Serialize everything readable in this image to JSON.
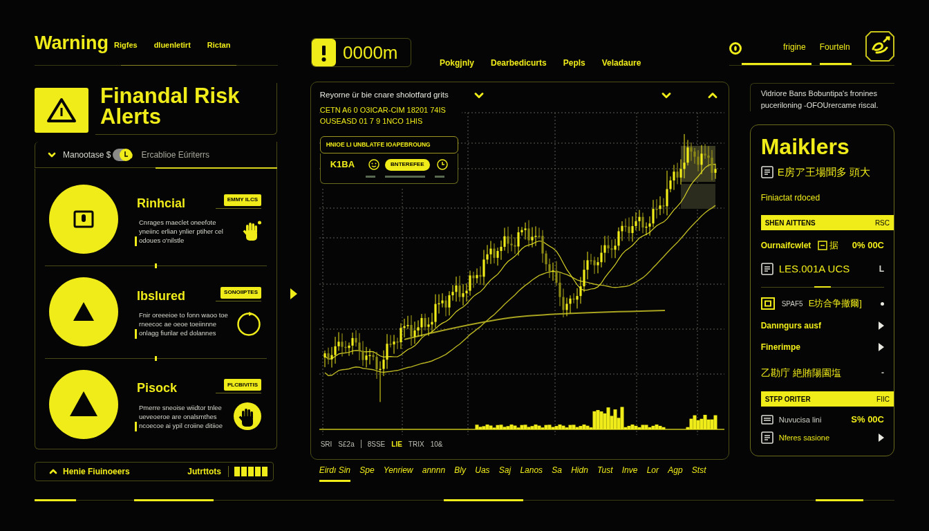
{
  "header": {
    "title": "Warning",
    "links": [
      "Rigfes",
      "dluenletirt",
      "Rictan"
    ]
  },
  "alert_panel": {
    "title": "Finandal Risk Alerts",
    "filter": {
      "label": "Manootase $",
      "secondary": "Ercablioe Eúriterrs"
    },
    "alerts": [
      {
        "kind": "device",
        "title": "Rinhcial",
        "badge": "EMMY ILCS",
        "description": "Cnrages maeclet oneefote yneiinc erlian ynlier ptiher cel odoues o'nilstle"
      },
      {
        "kind": "cycle",
        "title": "Ibslured",
        "badge": "SONOIIPTES",
        "description": "Fnir oreeeioe to fonn waoo toe rneecoc ae oeoe toeiinnne onlagg fiurilar ed dolannes"
      },
      {
        "kind": "payment",
        "title": "Pisock",
        "badge": "PLCBIVITIS",
        "description": "Pmerre sneoise wiidtor tnlee ueveoeroe are onalsmthes ncoecoe ai ypil croiine ditiioe"
      }
    ],
    "footer": {
      "label": "Henie Fiuinoeers",
      "action": "Jutrttots"
    }
  },
  "center": {
    "counter": "0000m",
    "nav": [
      "Pokgjnly",
      "Dearbedicurts",
      "Pepls",
      "Veladaure"
    ],
    "chart_panel": {
      "heading": "Reyorne ür bie cnare sholotfard grits",
      "lines": [
        "CETN A6 0 O3ICAR-CIM 18201 74IS",
        "OUSEASD 01 7 9 1NCO 1HIS"
      ],
      "info_card": {
        "title": "HNIOE LI UNBLATFE IOAPEBROUNG",
        "code": "K1BA",
        "action": "BNTEREFEE"
      },
      "axis_labels": [
        {
          "text": "SRI",
          "selected": false
        },
        {
          "text": "S£2a",
          "selected": false
        },
        {
          "text": "8SSE",
          "selected": false,
          "separated": true
        },
        {
          "text": "LIE",
          "selected": true
        },
        {
          "text": "TRIX",
          "selected": false
        },
        {
          "text": "10&",
          "selected": false
        }
      ]
    },
    "timeline": [
      {
        "label": "Eirdı Sin",
        "selected": true
      },
      {
        "label": "Spe",
        "selected": false
      },
      {
        "label": "Yenriew",
        "selected": false
      },
      {
        "label": "annnn",
        "selected": false
      },
      {
        "label": "Bly",
        "selected": false
      },
      {
        "label": "Uas",
        "selected": false
      },
      {
        "label": "Saj",
        "selected": false
      },
      {
        "label": "Lanos",
        "selected": false
      },
      {
        "label": "Sa",
        "selected": false
      },
      {
        "label": "Hidn",
        "selected": false
      },
      {
        "label": "Tust",
        "selected": false
      },
      {
        "label": "Inve",
        "selected": false
      },
      {
        "label": "Lor",
        "selected": false
      },
      {
        "label": "Agp",
        "selected": false
      },
      {
        "label": "Stst",
        "selected": false
      }
    ]
  },
  "right": {
    "nav": [
      {
        "label": "frigine",
        "selected": true
      },
      {
        "label": "Fourteln",
        "selected": true
      }
    ],
    "note": "Vidriore Bans Bobuntipa's fronines puceriloning -OFOUrercame riscal.",
    "panel": {
      "title": "Maiklers",
      "subtitle": "E房ア王場聞多 頭大",
      "caption": "Finiactat rdoced",
      "rows": [
        {
          "kind": "header",
          "label": "SHEN AITTENS",
          "tag": "RSC"
        },
        {
          "kind": "value",
          "label": "Ournaifcwlet",
          "note": "据",
          "value": "0% 00C"
        },
        {
          "kind": "doc",
          "label": "LES.001A UCS",
          "value": "L"
        },
        {
          "kind": "divider"
        },
        {
          "kind": "tagged",
          "code": "SPAF5",
          "label": "E坊合争撤爾]"
        },
        {
          "kind": "link",
          "label": "Danıngurs ausf"
        },
        {
          "kind": "link",
          "label": "Finerimpe"
        },
        {
          "kind": "plain",
          "label": "乙勘庁 絶賄陽園塩",
          "value": "-"
        },
        {
          "kind": "header",
          "label": "STFP ORITER",
          "tag": "FIIC"
        },
        {
          "kind": "monitor",
          "label": "Nuvucisa lini",
          "value": "S% 00C"
        },
        {
          "kind": "doc_link",
          "label": "Nferes sasione"
        }
      ]
    }
  }
}
